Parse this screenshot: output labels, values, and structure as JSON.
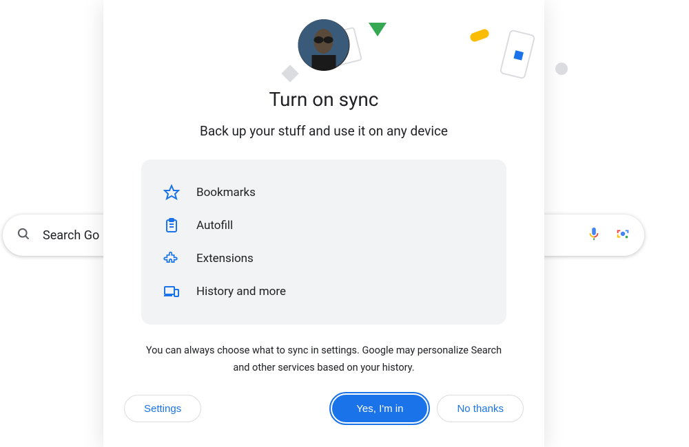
{
  "search": {
    "placeholder": "Search Google or type a URL",
    "visible_text": "Search Go"
  },
  "modal": {
    "title": "Turn on sync",
    "subtitle": "Back up your stuff and use it on any device",
    "features": [
      {
        "icon": "star-icon",
        "label": "Bookmarks"
      },
      {
        "icon": "clipboard-icon",
        "label": "Autofill"
      },
      {
        "icon": "puzzle-icon",
        "label": "Extensions"
      },
      {
        "icon": "devices-icon",
        "label": "History and more"
      }
    ],
    "disclaimer": "You can always choose what to sync in settings. Google may personalize Search and other services based on your history.",
    "buttons": {
      "settings": "Settings",
      "confirm": "Yes, I'm in",
      "decline": "No thanks"
    }
  },
  "colors": {
    "accent": "#1a73e8",
    "green": "#34a853",
    "yellow": "#fbbc04",
    "red": "#ea4335"
  }
}
